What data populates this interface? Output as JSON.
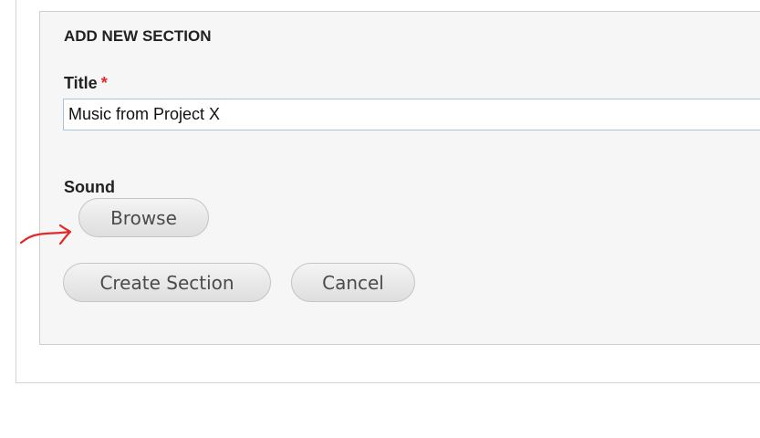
{
  "section": {
    "legend": "ADD NEW SECTION",
    "title_label": "Title",
    "required_marker": "*",
    "title_value": "Music from Project X",
    "sound_label": "Sound",
    "browse_label": "Browse",
    "create_label": "Create Section",
    "cancel_label": "Cancel"
  },
  "colors": {
    "required": "#e0292a",
    "annotation": "#e0292a",
    "input_border": "#a9c4dd"
  },
  "icons": {
    "annotation": "red-hand-drawn-arrow-icon"
  }
}
